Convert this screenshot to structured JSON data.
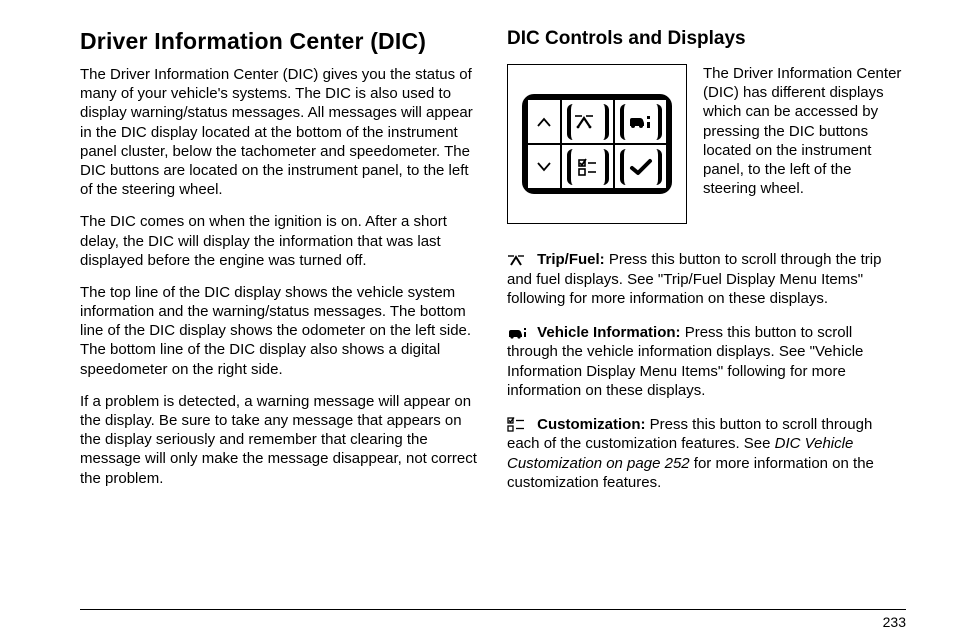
{
  "page_number": "233",
  "left": {
    "heading": "Driver Information Center (DIC)",
    "p1": "The Driver Information Center (DIC) gives you the status of many of your vehicle's systems. The DIC is also used to display warning/status messages. All messages will appear in the DIC display located at the bottom of the instrument panel cluster, below the tachometer and speedometer. The DIC buttons are located on the instrument panel, to the left of the steering wheel.",
    "p2": "The DIC comes on when the ignition is on. After a short delay, the DIC will display the information that was last displayed before the engine was turned off.",
    "p3": "The top line of the DIC display shows the vehicle system information and the warning/status messages. The bottom line of the DIC display shows the odometer on the left side. The bottom line of the DIC display also shows a digital speedometer on the right side.",
    "p4": "If a problem is detected, a warning message will appear on the display. Be sure to take any message that appears on the display seriously and remember that clearing the message will only make the message disappear, not correct the problem."
  },
  "right": {
    "heading": "DIC Controls and Displays",
    "intro": "The Driver Information Center (DIC) has different displays which can be accessed by pressing the DIC buttons located on the instrument panel, to the left of the steering wheel.",
    "entries": [
      {
        "icon": "trip-fuel-icon",
        "label": "Trip/Fuel:",
        "text": "  Press this button to scroll through the trip and fuel displays. See \"Trip/Fuel Display Menu Items\" following for more information on these displays."
      },
      {
        "icon": "vehicle-info-icon",
        "label": "Vehicle Information:",
        "text": "  Press this button to scroll through the vehicle information displays. See \"Vehicle Information Display Menu Items\" following for more information on these displays."
      },
      {
        "icon": "customization-icon",
        "label": "Customization:",
        "text_before": "  Press this button to scroll through each of the customization features. See ",
        "text_italic": "DIC Vehicle Customization on page 252",
        "text_after": " for more information on the customization features."
      }
    ]
  }
}
